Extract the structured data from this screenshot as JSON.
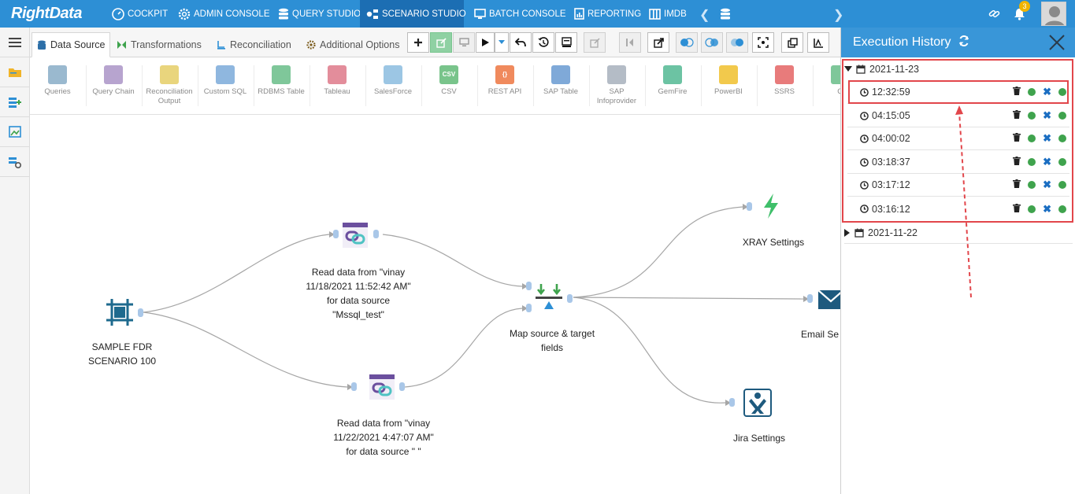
{
  "brand": {
    "logo": "RightData"
  },
  "nav": {
    "items": [
      {
        "label": "COCKPIT",
        "icon": "speedometer-icon"
      },
      {
        "label": "ADMIN CONSOLE",
        "icon": "gear-icon"
      },
      {
        "label": "QUERY STUDIO",
        "icon": "database-icon"
      },
      {
        "label": "SCENARIO STUDIO",
        "icon": "scenario-icon",
        "active": true
      },
      {
        "label": "BATCH CONSOLE",
        "icon": "monitor-icon"
      },
      {
        "label": "REPORTING",
        "icon": "report-icon"
      },
      {
        "label": "IMDB",
        "icon": "columns-icon"
      }
    ],
    "notification_count": "3"
  },
  "tabs": [
    {
      "label": "Data Source",
      "icon": "database-icon",
      "active": true
    },
    {
      "label": "Transformations",
      "icon": "transform-icon"
    },
    {
      "label": "Reconciliation",
      "icon": "reconcile-icon"
    },
    {
      "label": "Additional Options",
      "icon": "gear-icon"
    }
  ],
  "palette": [
    {
      "label": "Queries",
      "color": "#9ab9cf"
    },
    {
      "label": "Query Chain",
      "color": "#b7a4cf"
    },
    {
      "label": "Reconciliation Output",
      "color": "#e9d57d"
    },
    {
      "label": "Custom SQL",
      "color": "#8fb7df"
    },
    {
      "label": "RDBMS Table",
      "color": "#7fc79a"
    },
    {
      "label": "Tableau",
      "color": "#e38d9b"
    },
    {
      "label": "SalesForce",
      "color": "#9cc6e4"
    },
    {
      "label": "CSV",
      "color": "#79c48b",
      "badge": "CSV"
    },
    {
      "label": "REST API",
      "color": "#f08a5d",
      "badge": "{}"
    },
    {
      "label": "SAP Table",
      "color": "#7fa9d8"
    },
    {
      "label": "SAP Infoprovider",
      "color": "#b4bcc6"
    },
    {
      "label": "GemFire",
      "color": "#6cc3a3"
    },
    {
      "label": "PowerBI",
      "color": "#f2c94c"
    },
    {
      "label": "SSRS",
      "color": "#e87b7b"
    },
    {
      "label": "Q",
      "color": "#7fc79a"
    }
  ],
  "canvas": {
    "nodes": {
      "scenario": "SAMPLE FDR\nSCENARIO 100",
      "read1": "Read data from \"vinay\n11/18/2021 11:52:42 AM\"\nfor data source\n\"Mssql_test\"",
      "read2": "Read data from \"vinay\n11/22/2021 4:47:07 AM\"\nfor data source \" \"",
      "map": "Map source & target\nfields",
      "xray": "XRAY Settings",
      "email": "Email Se",
      "jira": "Jira Settings"
    }
  },
  "history": {
    "title": "Execution History",
    "dates": [
      {
        "date": "2021-11-23",
        "expanded": true,
        "runs": [
          {
            "time": "12:32:59",
            "highlighted": true
          },
          {
            "time": "04:15:05"
          },
          {
            "time": "04:00:02"
          },
          {
            "time": "03:18:37"
          },
          {
            "time": "03:17:12"
          },
          {
            "time": "03:16:12"
          }
        ]
      },
      {
        "date": "2021-11-22",
        "expanded": false
      }
    ]
  },
  "colors": {
    "nav_bg": "#2d8fd5",
    "nav_active": "#1c6eb3",
    "history_header": "#3996d8",
    "status_green": "#3fa34d",
    "annotation_red": "#e2464b"
  }
}
